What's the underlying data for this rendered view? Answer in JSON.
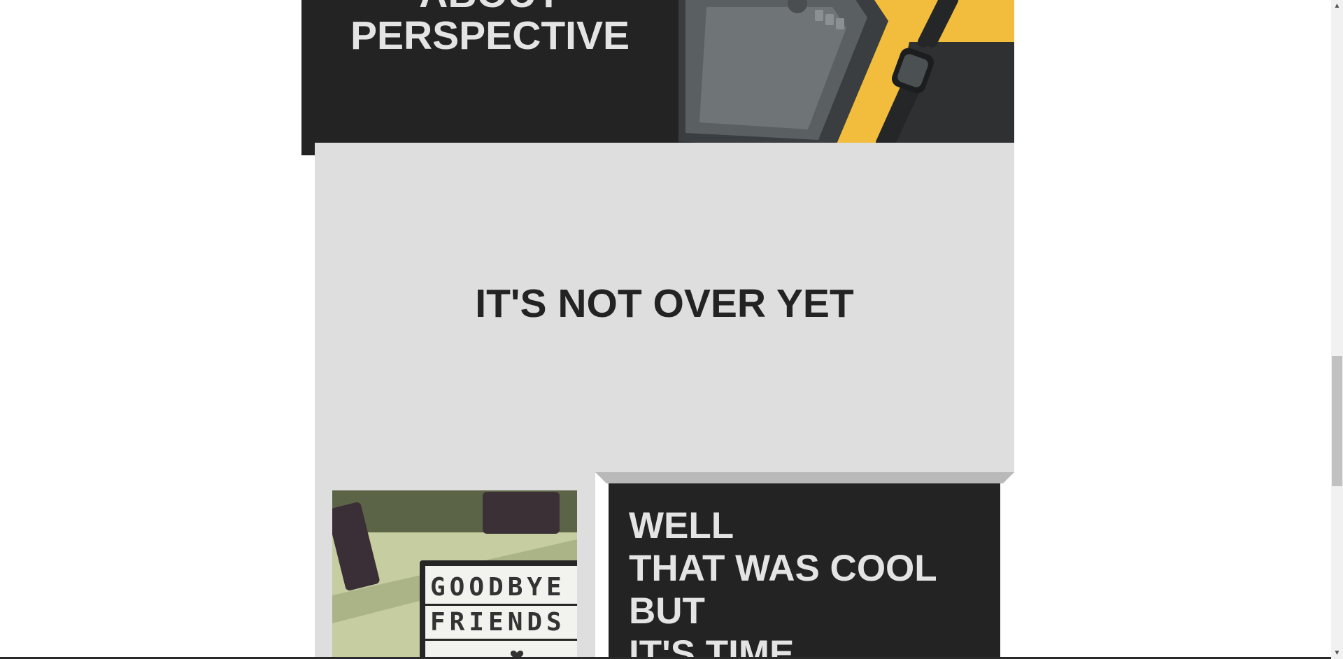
{
  "top_card": {
    "title_line1": "ABOUT",
    "title_line2": "PERSPECTIVE"
  },
  "section": {
    "heading": "IT'S NOT OVER YET"
  },
  "photo_sign": {
    "row1": "GOODBYE",
    "row2": "FRIENDS"
  },
  "bottom_card": {
    "line1": "WELL",
    "line2": "THAT WAS COOL",
    "line3": "BUT",
    "line4": "IT'S TIME"
  },
  "scrollbar": {
    "up_arrow": "▲",
    "down_arrow": "▼"
  },
  "colors": {
    "dark_card": "#232323",
    "grey_section": "#dedede",
    "card_text": "#e4e4e4",
    "accent_yellow": "#f2bd3c"
  }
}
